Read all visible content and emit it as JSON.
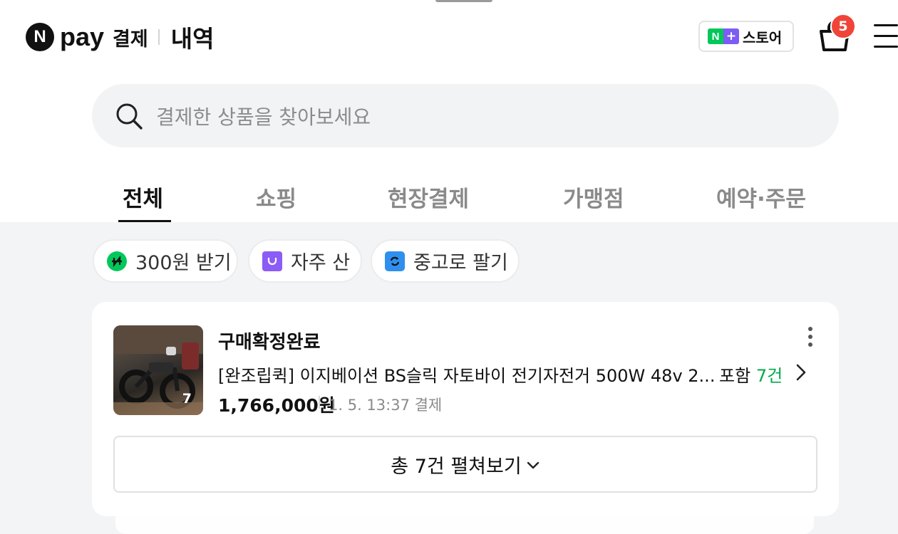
{
  "header": {
    "logo_letter": "N",
    "logo_pay": "pay",
    "logo_sub": "결제",
    "title": "내역",
    "store_n": "N",
    "store_plus": "+",
    "store_label": "스토어",
    "cart_badge": "5"
  },
  "search": {
    "placeholder": "결제한 상품을 찾아보세요"
  },
  "tabs": [
    {
      "label": "전체",
      "active": true
    },
    {
      "label": "쇼핑"
    },
    {
      "label": "현장결제"
    },
    {
      "label": "가맹점"
    },
    {
      "label": "예약·주문"
    }
  ],
  "chips": [
    {
      "label": "300원 받기",
      "icon": "n-point-icon"
    },
    {
      "label": "자주 산",
      "icon": "shopping-bag-icon"
    },
    {
      "label": "중고로 팔기",
      "icon": "recycle-icon"
    }
  ],
  "order": {
    "status": "구매확정완료",
    "product": "[완조립퀵] 이지베이션 BS슬릭 자토바이 전기자전거 500W 48v 2...",
    "includes_prefix": "포함",
    "includes_count": "7건",
    "thumb_count": "7",
    "price": "1,766,000원",
    "meta": "1. 5. 13:37 결제",
    "expand_label": "총 7건 펼쳐보기"
  },
  "colors": {
    "naver_green": "#03c75a",
    "badge_red": "#f04438",
    "accent_purple": "#7b5cf5"
  }
}
